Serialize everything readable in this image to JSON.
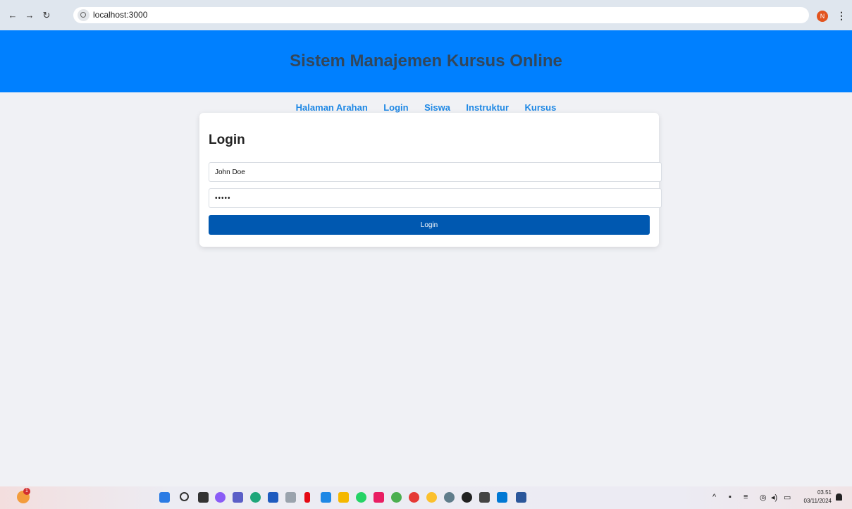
{
  "browser": {
    "url": "localhost:3000",
    "profile_initial": "N",
    "icons": {
      "back": "back-arrow-icon",
      "forward": "forward-arrow-icon",
      "reload": "reload-icon",
      "menu": "more-vert-icon"
    }
  },
  "header": {
    "title": "Sistem Manajemen Kursus Online"
  },
  "nav": {
    "items": [
      "Halaman Arahan",
      "Login",
      "Siswa",
      "Instruktur",
      "Kursus"
    ]
  },
  "login_form": {
    "heading": "Login",
    "username_value": "John Doe",
    "password_value": "•••••",
    "submit_label": "Login"
  },
  "taskbar": {
    "weather_badge": "1",
    "time": "03.51",
    "date": "03/11/2024"
  },
  "colors": {
    "header_bg": "#0080ff",
    "title_color": "#33475b",
    "nav_link": "#1e88e5",
    "button_bg": "#0058b0",
    "page_bg": "#f0f1f5"
  }
}
